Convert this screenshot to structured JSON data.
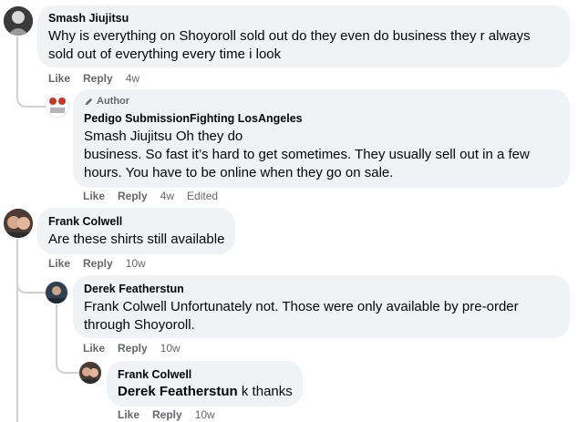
{
  "comments": [
    {
      "author": "Smash Jiujitsu",
      "text": "Why is everything on Shoyoroll sold out do they even do business they r always sold out of everything every time i look",
      "like": "Like",
      "reply": "Reply",
      "time": "4w"
    },
    {
      "badge": "Author",
      "author": "Pedigo SubmissionFighting LosAngeles",
      "line1": "Smash Jiujitsu Oh they do",
      "line2": "business. So fast it’s hard to get sometimes. They usually sell out in a few hours. You have to be online when they go on sale.",
      "like": "Like",
      "reply": "Reply",
      "time": "4w",
      "edited": "Edited"
    },
    {
      "author": "Frank Colwell",
      "text": "Are these shirts still available",
      "like": "Like",
      "reply": "Reply",
      "time": "10w"
    },
    {
      "author": "Derek Featherstun",
      "text": "Frank Colwell Unfortunately not. Those were only available by pre-order through Shoyoroll.",
      "like": "Like",
      "reply": "Reply",
      "time": "10w"
    },
    {
      "author": "Frank Colwell",
      "mention": "Derek Featherstun",
      "text": " k thanks",
      "like": "Like",
      "reply": "Reply",
      "time": "10w"
    }
  ]
}
